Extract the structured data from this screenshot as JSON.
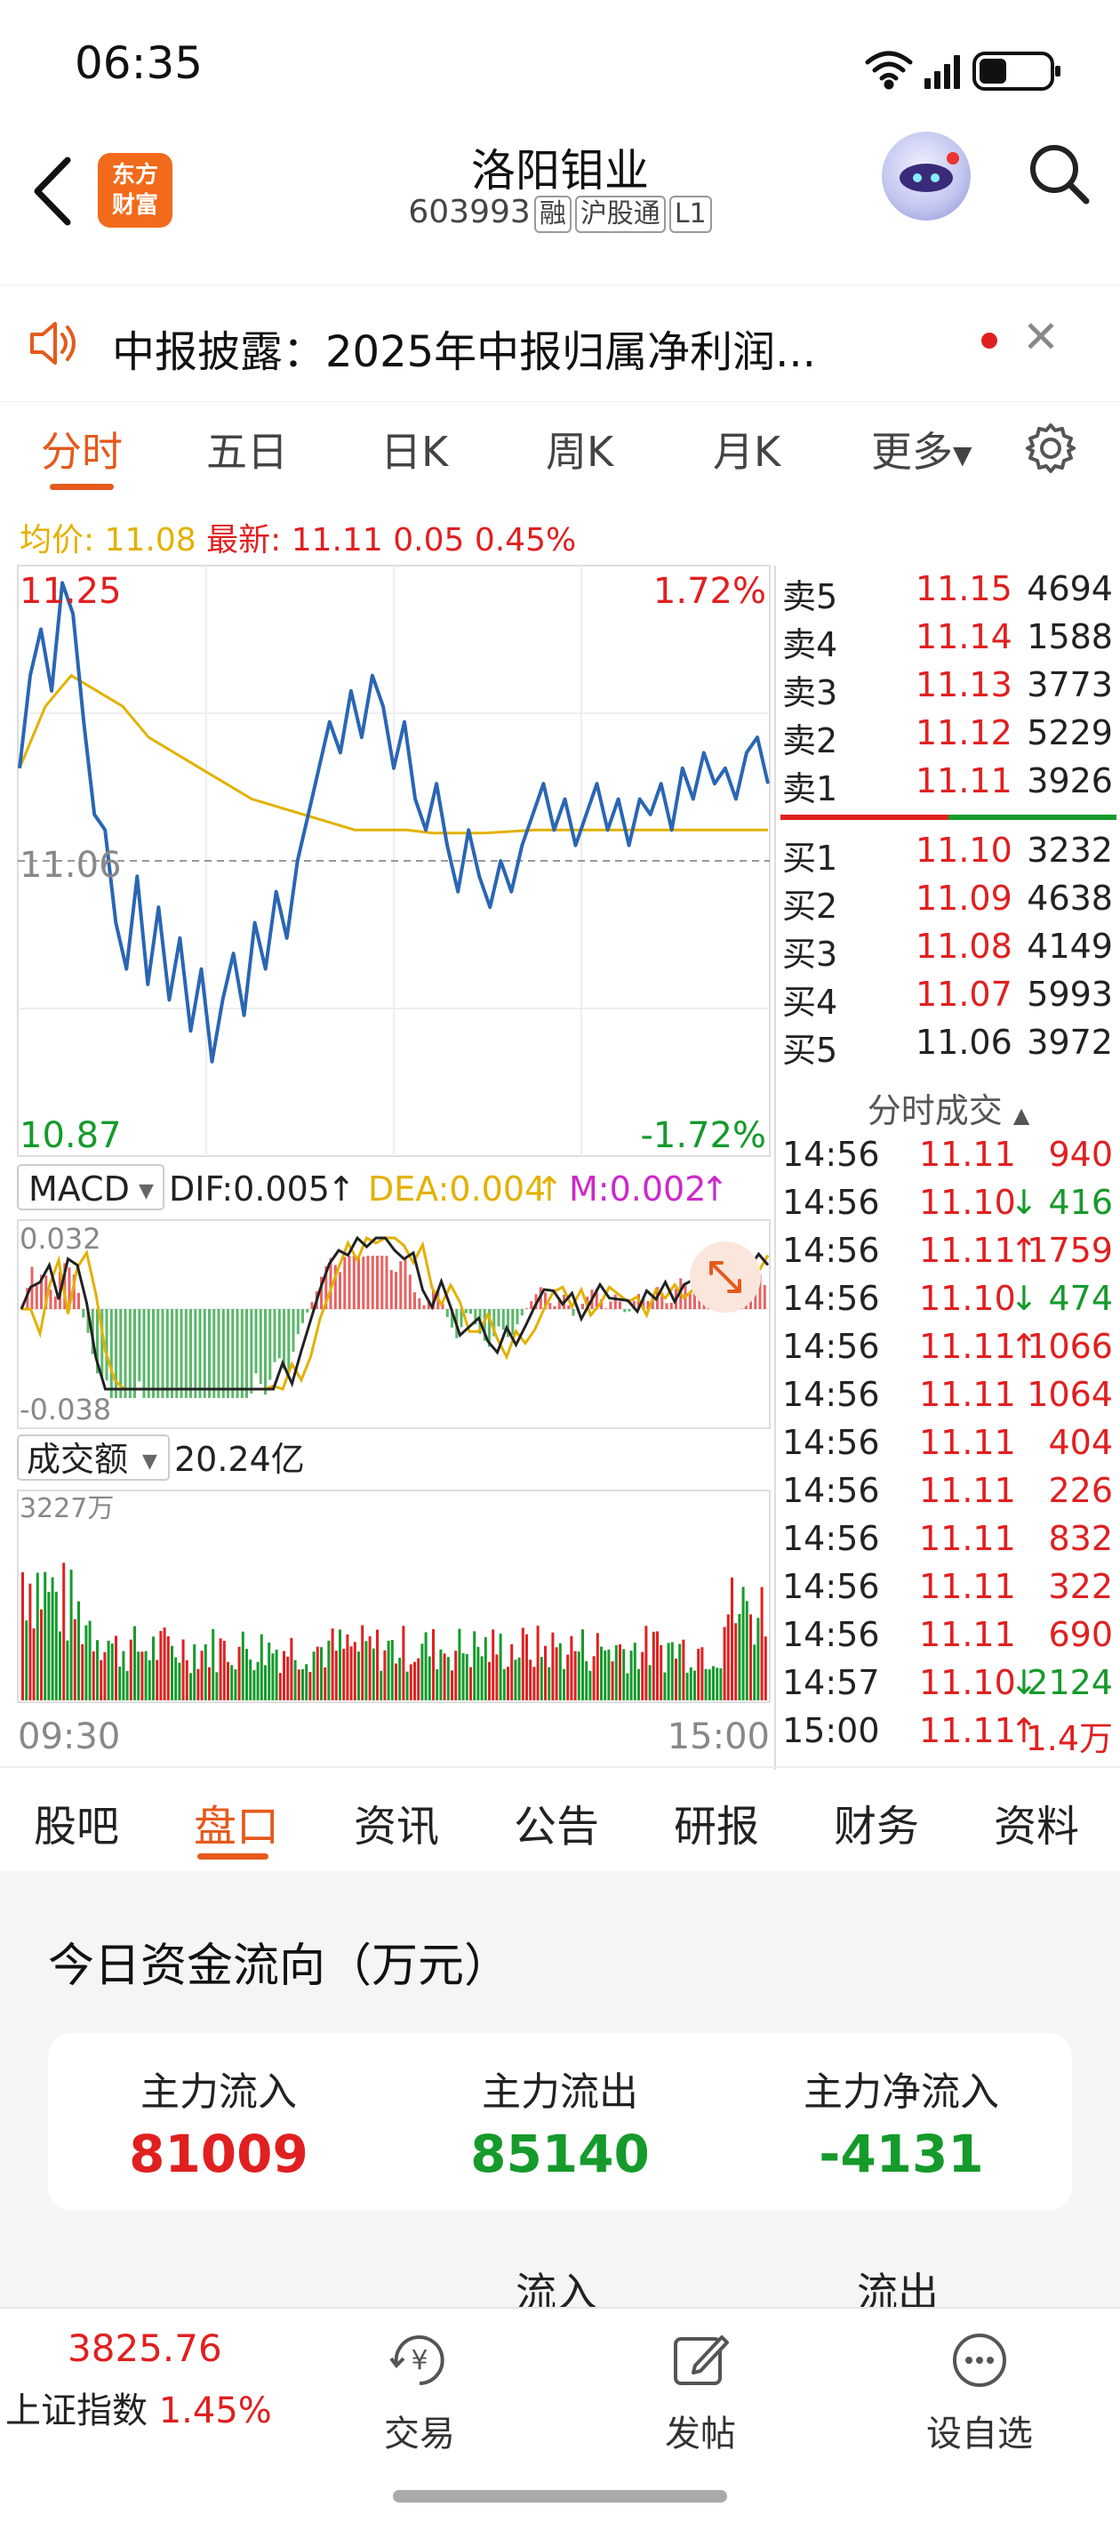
{
  "status": {
    "time": "06:35"
  },
  "header": {
    "logo_line1": "东方",
    "logo_line2": "财富",
    "name": "洛阳钼业",
    "code": "603993",
    "tags": [
      "融",
      "沪股通",
      "L1"
    ]
  },
  "notice": {
    "text": "中报披露：2025年中报归属净利润..."
  },
  "period_tabs": [
    "分时",
    "五日",
    "日K",
    "周K",
    "月K",
    "更多"
  ],
  "active_period": "分时",
  "info": {
    "avg_label": "均价:",
    "avg": "11.08",
    "latest_label": "最新:",
    "latest": "11.11",
    "change": "0.05",
    "pct": "0.45%"
  },
  "colors": {
    "up": "#e02020",
    "down": "#159a2b",
    "accent": "#e55a1c",
    "avg_line": "#e3b100",
    "price_line": "#2a66b3"
  },
  "chart_data": {
    "type": "line",
    "title": "",
    "price_axis": {
      "top": "11.25",
      "mid": "11.06",
      "bottom": "10.87",
      "top_pct": "1.72%",
      "bottom_pct": "-1.72%"
    },
    "ylim": [
      10.87,
      11.25
    ],
    "prev_close": 11.06,
    "time_labels": [
      "09:30",
      "15:00"
    ],
    "series": [
      {
        "name": "price",
        "values": [
          11.12,
          11.18,
          11.21,
          11.17,
          11.24,
          11.22,
          11.15,
          11.09,
          11.08,
          11.02,
          10.99,
          11.05,
          10.98,
          11.03,
          10.97,
          11.01,
          10.95,
          10.99,
          10.93,
          10.97,
          11.0,
          10.96,
          11.02,
          10.99,
          11.04,
          11.01,
          11.06,
          11.09,
          11.12,
          11.15,
          11.13,
          11.17,
          11.14,
          11.18,
          11.16,
          11.12,
          11.15,
          11.1,
          11.08,
          11.11,
          11.07,
          11.04,
          11.08,
          11.05,
          11.03,
          11.06,
          11.04,
          11.07,
          11.09,
          11.11,
          11.08,
          11.1,
          11.07,
          11.09,
          11.11,
          11.08,
          11.1,
          11.07,
          11.1,
          11.09,
          11.11,
          11.08,
          11.12,
          11.1,
          11.13,
          11.11,
          11.12,
          11.1,
          11.13,
          11.14,
          11.11
        ]
      },
      {
        "name": "avg",
        "values": [
          11.12,
          11.16,
          11.18,
          11.17,
          11.16,
          11.14,
          11.13,
          11.12,
          11.11,
          11.1,
          11.095,
          11.09,
          11.085,
          11.08,
          11.08,
          11.08,
          11.078,
          11.078,
          11.078,
          11.079,
          11.08,
          11.08,
          11.08,
          11.08,
          11.08,
          11.08,
          11.08,
          11.08,
          11.08,
          11.08
        ]
      }
    ],
    "macd": {
      "label": "MACD",
      "dif": "DIF:0.005",
      "dea": "DEA:0.004",
      "m": "M:0.002",
      "top": "0.032",
      "bottom": "-0.038"
    },
    "volume": {
      "label": "成交额",
      "total": "20.24亿",
      "max": "3227万"
    }
  },
  "order_book": {
    "asks": [
      {
        "label": "卖5",
        "price": "11.15",
        "vol": "4694"
      },
      {
        "label": "卖4",
        "price": "11.14",
        "vol": "1588"
      },
      {
        "label": "卖3",
        "price": "11.13",
        "vol": "3773"
      },
      {
        "label": "卖2",
        "price": "11.12",
        "vol": "5229"
      },
      {
        "label": "卖1",
        "price": "11.11",
        "vol": "3926"
      }
    ],
    "bids": [
      {
        "label": "买1",
        "price": "11.10",
        "vol": "3232"
      },
      {
        "label": "买2",
        "price": "11.09",
        "vol": "4638"
      },
      {
        "label": "买3",
        "price": "11.08",
        "vol": "4149"
      },
      {
        "label": "买4",
        "price": "11.07",
        "vol": "5993"
      },
      {
        "label": "买5",
        "price": "11.06",
        "vol": "3972"
      }
    ]
  },
  "trades": {
    "title": "分时成交",
    "rows": [
      {
        "time": "14:56",
        "price": "11.11",
        "arrow": "",
        "vol": "940",
        "dir": "up"
      },
      {
        "time": "14:56",
        "price": "11.10",
        "arrow": "↓",
        "vol": "416",
        "dir": "down"
      },
      {
        "time": "14:56",
        "price": "11.11",
        "arrow": "↑",
        "vol": "1759",
        "dir": "up"
      },
      {
        "time": "14:56",
        "price": "11.10",
        "arrow": "↓",
        "vol": "474",
        "dir": "down"
      },
      {
        "time": "14:56",
        "price": "11.11",
        "arrow": "↑",
        "vol": "1066",
        "dir": "up"
      },
      {
        "time": "14:56",
        "price": "11.11",
        "arrow": "",
        "vol": "1064",
        "dir": "up"
      },
      {
        "time": "14:56",
        "price": "11.11",
        "arrow": "",
        "vol": "404",
        "dir": "up"
      },
      {
        "time": "14:56",
        "price": "11.11",
        "arrow": "",
        "vol": "226",
        "dir": "up"
      },
      {
        "time": "14:56",
        "price": "11.11",
        "arrow": "",
        "vol": "832",
        "dir": "up"
      },
      {
        "time": "14:56",
        "price": "11.11",
        "arrow": "",
        "vol": "322",
        "dir": "up"
      },
      {
        "time": "14:56",
        "price": "11.11",
        "arrow": "",
        "vol": "690",
        "dir": "up"
      },
      {
        "time": "14:57",
        "price": "11.10",
        "arrow": "↓",
        "vol": "2124",
        "dir": "down"
      },
      {
        "time": "15:00",
        "price": "11.11",
        "arrow": "↑",
        "vol": "1.4万",
        "dir": "up"
      }
    ]
  },
  "sub_tabs": [
    "股吧",
    "盘口",
    "资讯",
    "公告",
    "研报",
    "财务",
    "资料"
  ],
  "active_sub_tab": "盘口",
  "fund_flow": {
    "title": "今日资金流向（万元）",
    "inflow_label": "主力流入",
    "inflow": "81009",
    "outflow_label": "主力流出",
    "outflow": "85140",
    "net_label": "主力净流入",
    "net": "-4131",
    "col_in": "流入",
    "col_out": "流出"
  },
  "bottom_bar": {
    "index_value": "3825.76",
    "index_name": "上证指数",
    "index_pct": "1.45%",
    "trade": "交易",
    "post": "发帖",
    "watch": "设自选"
  }
}
